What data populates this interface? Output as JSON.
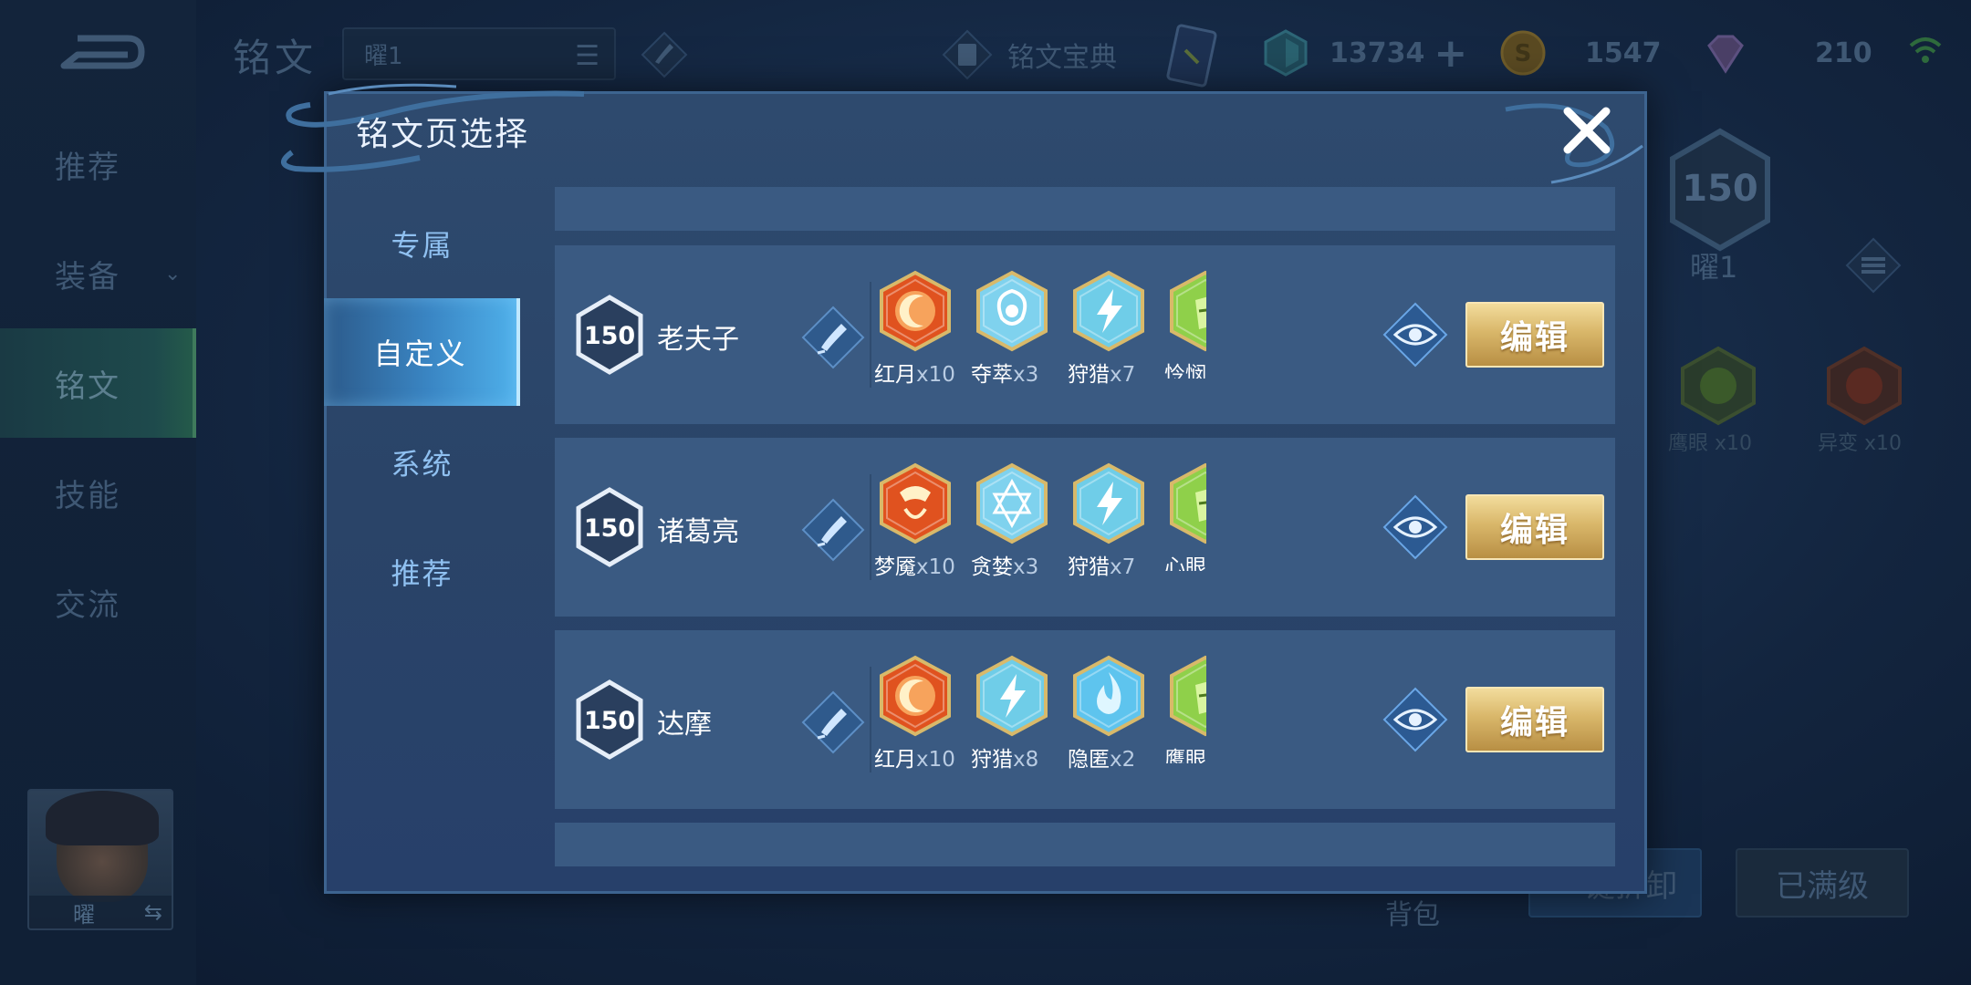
{
  "background": {
    "nav": {
      "items": [
        {
          "label": "推荐"
        },
        {
          "label": "装备"
        },
        {
          "label": "铭文"
        },
        {
          "label": "技能"
        },
        {
          "label": "交流"
        }
      ]
    },
    "title": "铭文",
    "page_select": "曜1",
    "book_label": "铭文宝典",
    "currency": [
      {
        "icon": "crystal-icon",
        "value": "13734"
      },
      {
        "icon": "gold-coin-icon",
        "value": "1547"
      },
      {
        "icon": "gem-icon",
        "value": "210"
      }
    ],
    "level": "150",
    "level_name": "曜1",
    "runes": [
      {
        "name": "鹰眼",
        "count": "x10"
      },
      {
        "name": "异变",
        "count": "x10"
      }
    ],
    "backpack": "背包",
    "btn_unload": "一键拆卸",
    "btn_maxed": "已满级",
    "hero": {
      "name": "曜",
      "swap": "⇆"
    }
  },
  "modal": {
    "title": "铭文页选择",
    "tabs": [
      {
        "label": "专属"
      },
      {
        "label": "自定义"
      },
      {
        "label": "系统"
      },
      {
        "label": "推荐"
      }
    ],
    "active_tab": "自定义",
    "pages": [
      {
        "level": "150",
        "name": "老夫子",
        "runes": [
          {
            "name": "红月",
            "count": "x10",
            "icon": "red-moon-icon",
            "color": "#e0521f"
          },
          {
            "name": "夺萃",
            "count": "x3",
            "icon": "knot-icon",
            "color": "#7fd2ee"
          },
          {
            "name": "狩猎",
            "count": "x7",
            "icon": "lightning-icon",
            "color": "#6fcde8"
          },
          {
            "name": "怜悯",
            "count": "",
            "icon": "green-rune-icon",
            "color": "#8fd04a"
          }
        ],
        "edit_label": "编辑"
      },
      {
        "level": "150",
        "name": "诸葛亮",
        "runes": [
          {
            "name": "梦魇",
            "count": "x10",
            "icon": "nightmare-icon",
            "color": "#e0521f"
          },
          {
            "name": "贪婪",
            "count": "x3",
            "icon": "hexagram-icon",
            "color": "#7fd2ee"
          },
          {
            "name": "狩猎",
            "count": "x7",
            "icon": "lightning-icon",
            "color": "#6fcde8"
          },
          {
            "name": "心眼",
            "count": "",
            "icon": "green-rune-icon",
            "color": "#8fd04a"
          }
        ],
        "edit_label": "编辑"
      },
      {
        "level": "150",
        "name": "达摩",
        "runes": [
          {
            "name": "红月",
            "count": "x10",
            "icon": "red-moon-icon",
            "color": "#e0521f"
          },
          {
            "name": "狩猎",
            "count": "x8",
            "icon": "lightning-icon",
            "color": "#6fcde8"
          },
          {
            "name": "隐匿",
            "count": "x2",
            "icon": "flame-icon",
            "color": "#5ec4ee"
          },
          {
            "name": "鹰眼",
            "count": "",
            "icon": "green-rune-icon",
            "color": "#8fd04a"
          }
        ],
        "edit_label": "编辑"
      }
    ]
  },
  "colors": {
    "accent_gold": "#d9b76a",
    "tab_active": "#3a86c4",
    "row_bg": "#3a5a82"
  }
}
